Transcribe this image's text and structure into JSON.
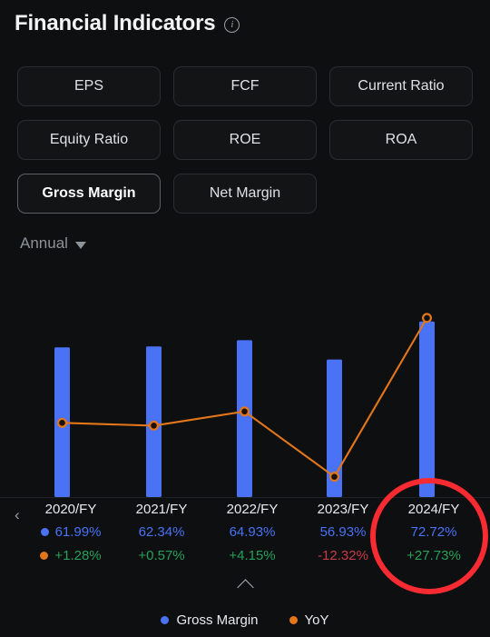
{
  "header": {
    "title": "Financial Indicators",
    "info_icon": "info-circle-icon"
  },
  "tabs": [
    {
      "label": "EPS",
      "selected": false
    },
    {
      "label": "FCF",
      "selected": false
    },
    {
      "label": "Current Ratio",
      "selected": false
    },
    {
      "label": "Equity Ratio",
      "selected": false
    },
    {
      "label": "ROE",
      "selected": false
    },
    {
      "label": "ROA",
      "selected": false
    },
    {
      "label": "Gross Margin",
      "selected": true
    },
    {
      "label": "Net Margin",
      "selected": false
    }
  ],
  "period_selector": {
    "value": "Annual",
    "caret_icon": "chevron-down-icon"
  },
  "nav": {
    "prev_icon": "chevron-left-icon",
    "prev_glyph": "‹",
    "collapse_icon": "chevron-up-icon"
  },
  "legend": [
    {
      "label": "Gross Margin",
      "color": "#4a72f5"
    },
    {
      "label": "YoY",
      "color": "#e3761a"
    }
  ],
  "annotation": {
    "type": "ellipse-highlight",
    "color": "#f92b32",
    "target": "2024/FY"
  },
  "table": {
    "columns": [
      {
        "period": "2020/FY",
        "gross_margin": "61.99%",
        "yoy": "+1.28%",
        "yoy_sign": "pos"
      },
      {
        "period": "2021/FY",
        "gross_margin": "62.34%",
        "yoy": "+0.57%",
        "yoy_sign": "pos"
      },
      {
        "period": "2022/FY",
        "gross_margin": "64.93%",
        "yoy": "+4.15%",
        "yoy_sign": "pos"
      },
      {
        "period": "2023/FY",
        "gross_margin": "56.93%",
        "yoy": "-12.32%",
        "yoy_sign": "neg"
      },
      {
        "period": "2024/FY",
        "gross_margin": "72.72%",
        "yoy": "+27.73%",
        "yoy_sign": "pos"
      }
    ]
  },
  "chart_data": {
    "type": "bar",
    "title": "Gross Margin",
    "xlabel": "",
    "ylabel": "",
    "grid": false,
    "legend_position": "bottom",
    "categories": [
      "2020/FY",
      "2021/FY",
      "2022/FY",
      "2023/FY",
      "2024/FY"
    ],
    "series": [
      {
        "name": "Gross Margin",
        "type": "bar",
        "color": "#4a72f5",
        "unit": "%",
        "values": [
          61.99,
          62.34,
          64.93,
          56.93,
          72.72
        ]
      },
      {
        "name": "YoY",
        "type": "line",
        "color": "#e3761a",
        "unit": "%",
        "values": [
          1.28,
          0.57,
          4.15,
          -12.32,
          27.73
        ]
      }
    ],
    "bar_axis": {
      "min": 0,
      "max": 76
    },
    "line_axis": {
      "min": -14,
      "max": 30
    }
  }
}
